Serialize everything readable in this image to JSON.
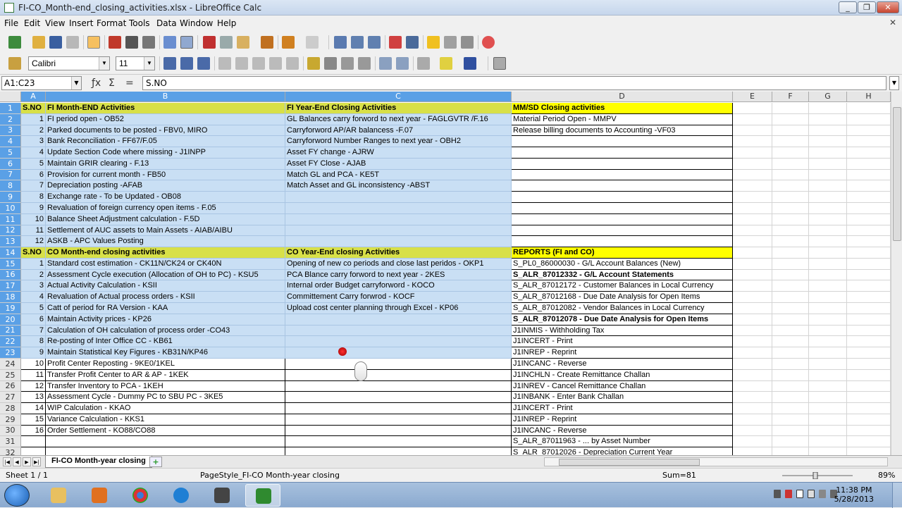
{
  "window": {
    "title": "FI-CO_Month-end_closing_activities.xlsx - LibreOffice Calc"
  },
  "menubar": [
    "File",
    "Edit",
    "View",
    "Insert",
    "Format",
    "Tools",
    "Data",
    "Window",
    "Help"
  ],
  "toolbar": {
    "font_name": "Calibri",
    "font_size": "11"
  },
  "formula_bar": {
    "name_box": "A1:C23",
    "content": "S.NO"
  },
  "columns": [
    "A",
    "B",
    "C",
    "D",
    "E",
    "F",
    "G",
    "H"
  ],
  "rows": [
    {
      "n": "1",
      "a": "S.NO",
      "b": "FI Month-END Activities",
      "c": "FI Year-End Closing Activities",
      "d": "MM/SD Closing activities"
    },
    {
      "n": "2",
      "a": "1",
      "b": " FI period open - OB52",
      "c": "GL Balances carry forword to next year - FAGLGVTR /F.16",
      "d": "Material Period Open - MMPV"
    },
    {
      "n": "3",
      "a": "2",
      "b": " Parked documents to be posted - FBV0, MIRO",
      "c": "Carryforword AP/AR balancess -F.07",
      "d": "Release billing documents to Accounting -VF03"
    },
    {
      "n": "4",
      "a": "3",
      "b": " Bank Reconciliation - FF67/F.05",
      "c": "Carryforword Number Ranges to next year - OBH2",
      "d": ""
    },
    {
      "n": "5",
      "a": "4",
      "b": "Update Section Code where missing - J1INPP",
      "c": "Asset FY change  - AJRW",
      "d": ""
    },
    {
      "n": "6",
      "a": "5",
      "b": "Maintain GRIR clearing - F.13",
      "c": "Asset FY Close   -    AJAB",
      "d": ""
    },
    {
      "n": "7",
      "a": "6",
      "b": "Provision for current month - FB50",
      "c": "Match GL and PCA - KE5T",
      "d": ""
    },
    {
      "n": "8",
      "a": "7",
      "b": "Depreciation posting -AFAB",
      "c": "Match Asset and GL inconsistency -ABST",
      "d": ""
    },
    {
      "n": "9",
      "a": "8",
      "b": "Exchange rate - To be Updated - OB08",
      "c": "",
      "d": ""
    },
    {
      "n": "10",
      "a": "9",
      "b": "Revaluation of foreign currency open items - F.05",
      "c": "",
      "d": ""
    },
    {
      "n": "11",
      "a": "10",
      "b": " Balance Sheet Adjustment calculation - F.5D",
      "c": "",
      "d": ""
    },
    {
      "n": "12",
      "a": "11",
      "b": "Settlement of AUC assets to Main Assets - AIAB/AIBU",
      "c": "",
      "d": ""
    },
    {
      "n": "13",
      "a": "12",
      "b": "ASKB - APC Values Posting",
      "c": "",
      "d": ""
    },
    {
      "n": "14",
      "a": "S.NO",
      "b": "CO Month-end closing activities",
      "c": "CO Year-End closing Activities",
      "d": "REPORTS (FI and CO)"
    },
    {
      "n": "15",
      "a": "1",
      "b": "Standard cost estimation - CK11N/CK24  or CK40N",
      "c": "Opening of new co periods and close last peridos - OKP1",
      "d": "S_PL0_86000030 - G/L Account Balances (New)"
    },
    {
      "n": "16",
      "a": "2",
      "b": "Assessment Cycle execution (Allocation of OH to PC) - KSU5",
      "c": "PCA Blance carry forword to next year - 2KES",
      "d": "S_ALR_87012332 - G/L Account Statements"
    },
    {
      "n": "17",
      "a": "3",
      "b": "Actual Activity Calculation - KSII",
      "c": "Internal order Budget carryforword - KOCO",
      "d": "S_ALR_87012172 - Customer Balances in Local Currency"
    },
    {
      "n": "18",
      "a": "4",
      "b": "Revaluation of Actual process orders -  KSII",
      "c": "Committement Carry forwrod  - KOCF",
      "d": "S_ALR_87012168 - Due Date Analysis for Open Items"
    },
    {
      "n": "19",
      "a": "5",
      "b": "Catt of period for RA Version - KAA",
      "c": "Upload cost center planning through Excel - KP06",
      "d": "S_ALR_87012082 - Vendor Balances in Local Currency"
    },
    {
      "n": "20",
      "a": "6",
      "b": "Maintain Activity prices - KP26",
      "c": "",
      "d": "S_ALR_87012078 - Due Date Analysis for Open Items"
    },
    {
      "n": "21",
      "a": "7",
      "b": "Calculation of OH calculation of process order -CO43",
      "c": "",
      "d": "J1INMIS - Withholding Tax"
    },
    {
      "n": "22",
      "a": "8",
      "b": "Re-posting of Inter Office CC - KB61",
      "c": "",
      "d": "J1INCERT - Print"
    },
    {
      "n": "23",
      "a": "9",
      "b": "Maintain Statistical Key Figures - KB31N/KP46",
      "c": "",
      "d": "J1INREP - Reprint"
    },
    {
      "n": "24",
      "a": "10",
      "b": "Profit Center Reposting - 9KE0/1KEL",
      "c": "",
      "d": "J1INCANC - Reverse"
    },
    {
      "n": "25",
      "a": "11",
      "b": "Transfer Profit Center to AR & AP - 1KEK",
      "c": "",
      "d": "J1INCHLN - Create Remittance Challan"
    },
    {
      "n": "26",
      "a": "12",
      "b": "Transfer Inventory to PCA - 1KEH",
      "c": "",
      "d": "J1INREV - Cancel Remittance Challan"
    },
    {
      "n": "27",
      "a": "13",
      "b": "Assessment Cycle - Dummy PC to SBU PC - 3KE5",
      "c": "",
      "d": "J1INBANK - Enter Bank Challan"
    },
    {
      "n": "28",
      "a": "14",
      "b": "WIP Calculation - KKAO",
      "c": "",
      "d": "J1INCERT - Print"
    },
    {
      "n": "29",
      "a": "15",
      "b": "Variance Calculation - KKS1",
      "c": "",
      "d": "J1INREP - Reprint"
    },
    {
      "n": "30",
      "a": "16",
      "b": "Order Settlement - KO88/CO88",
      "c": "",
      "d": "J1INCANC - Reverse"
    },
    {
      "n": "31",
      "a": "",
      "b": "",
      "c": "",
      "d": "S_ALR_87011963 - ... by Asset Number"
    },
    {
      "n": "32",
      "a": "",
      "b": "",
      "c": "",
      "d": "S_ALR_87012026 - Depreciation Current Year"
    }
  ],
  "sheet_tab": "FI-CO Month-year closing",
  "status": {
    "sheet": "Sheet 1 / 1",
    "page_style": "PageStyle_FI-CO Month-year closing",
    "sum": "Sum=81",
    "zoom": "89%"
  },
  "clock": {
    "time": "11:38 PM",
    "date": "5/28/2013"
  },
  "colors": {
    "selection": "#c9dff4",
    "header_yellow": "#d8e048",
    "header_bright_yellow": "#ffff00",
    "column_header_selected": "#5aa0e6"
  }
}
